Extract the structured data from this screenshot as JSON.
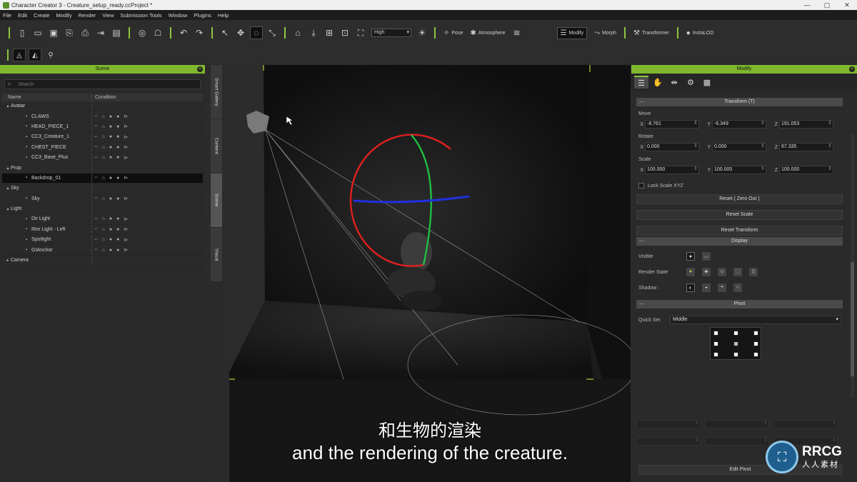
{
  "window": {
    "title": "Character Creator 3 - Creature_setup_ready.ccProject *",
    "controls": [
      "—",
      "▢",
      "✕"
    ]
  },
  "menu": [
    "File",
    "Edit",
    "Create",
    "Modify",
    "Render",
    "View",
    "Submission Tools",
    "Window",
    "Plugins",
    "Help"
  ],
  "toolbar": {
    "quality": "High",
    "pose_label": "Pose",
    "atmosphere_label": "Atmosphere",
    "modify_label": "Modify",
    "morph_label": "Morph",
    "transformer_label": "Transformer",
    "instalod_label": "InstaLOD"
  },
  "scene": {
    "title": "Scene",
    "search_placeholder": "Search",
    "columns": [
      "Name",
      "Condition"
    ],
    "rows": [
      {
        "name": "Avatar",
        "type": "group",
        "expanded": true
      },
      {
        "name": "CLAWS",
        "type": "child"
      },
      {
        "name": "HEAD_PIECE_1",
        "type": "child"
      },
      {
        "name": "CC3_Creature_1",
        "type": "child"
      },
      {
        "name": "CHEST_PIECE",
        "type": "child"
      },
      {
        "name": "CC3_Base_Plus",
        "type": "child"
      },
      {
        "name": "Prop",
        "type": "group",
        "expanded": true
      },
      {
        "name": "Backdrop_01",
        "type": "child",
        "selected": true
      },
      {
        "name": "Sky",
        "type": "group",
        "expanded": true
      },
      {
        "name": "Sky",
        "type": "child"
      },
      {
        "name": "Light",
        "type": "group",
        "expanded": true
      },
      {
        "name": "Dir Light",
        "type": "child"
      },
      {
        "name": "Rim Light - Left",
        "type": "child"
      },
      {
        "name": "Spotlight",
        "type": "child"
      },
      {
        "name": "GIAnchor",
        "type": "child"
      },
      {
        "name": "Camera",
        "type": "group",
        "expanded": false
      }
    ]
  },
  "side_tabs": [
    "Smart Gallery",
    "Content",
    "Scene",
    "Visual"
  ],
  "modify": {
    "title": "Modify",
    "transform_section": "Transform  (T)",
    "move_label": "Move",
    "rotate_label": "Rotate",
    "scale_label": "Scale",
    "axes": [
      "X",
      "Y",
      "Z"
    ],
    "move": [
      "-8.761",
      "-6.349",
      "191.053"
    ],
    "rotate": [
      "0.000",
      "0.000",
      "67.335"
    ],
    "scale": [
      "100.000",
      "100.000",
      "100.000"
    ],
    "lock_scale": "Lock Scale XYZ",
    "reset_zero": "Reset ( Zero Out )",
    "reset_scale": "Reset Scale",
    "reset_transform": "Reset Transform",
    "display_section": "Display",
    "visible_label": "Visible",
    "render_state_label": "Render State",
    "shadow_label": "Shadow :",
    "pivot_section": "Pivot",
    "quick_set_label": "Quick Set",
    "quick_set_value": "Middle",
    "edit_pivot": "Edit Pivot"
  },
  "subtitles": {
    "cn": "和生物的渲染",
    "en": "and the rendering of the creature."
  },
  "watermark": {
    "text": "RRCG",
    "subtext": "人人素材"
  },
  "colors": {
    "accent": "#8cc63f",
    "gizmo_x": "#e02020",
    "gizmo_y": "#20c040",
    "gizmo_z": "#2030e0"
  }
}
